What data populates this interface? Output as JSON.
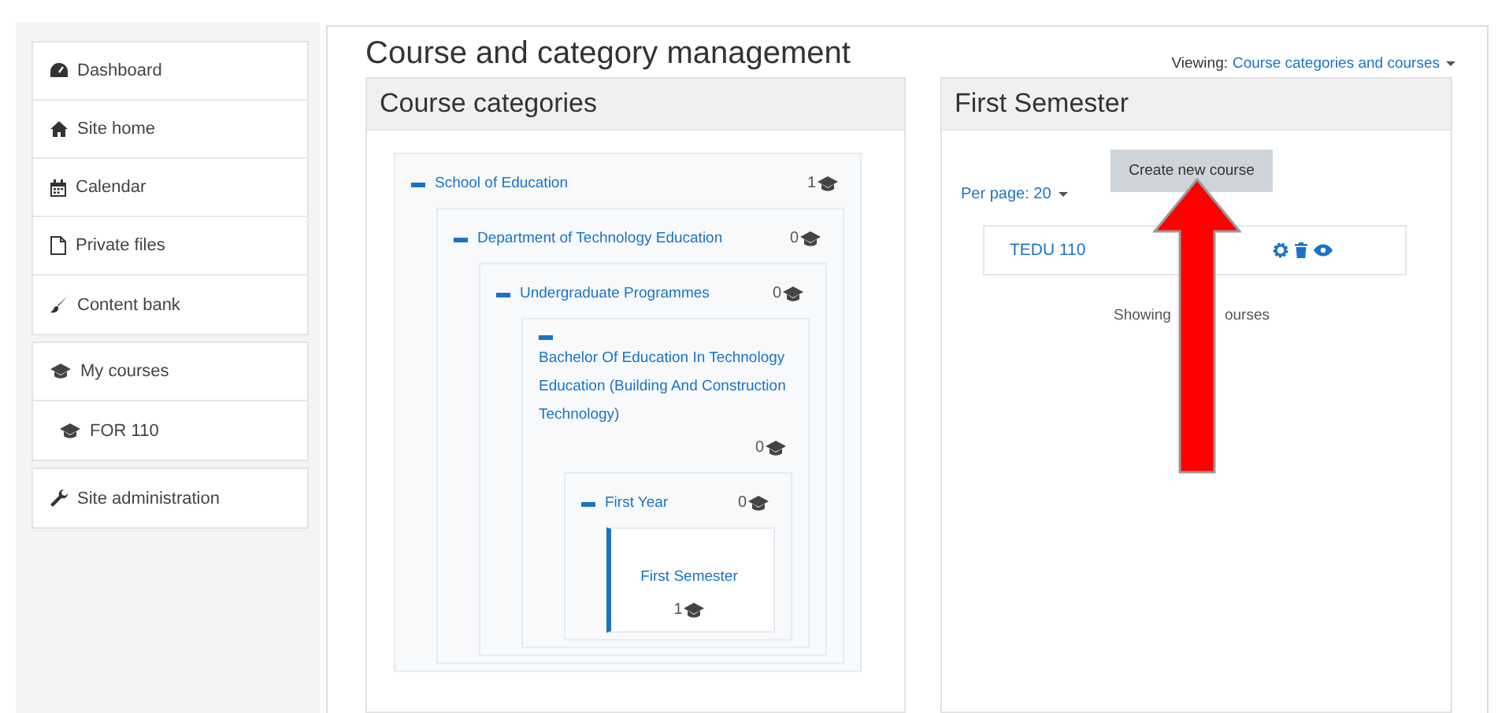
{
  "sidebar": {
    "groups": [
      {
        "items": [
          {
            "label": "Dashboard",
            "kind": "dashboard"
          },
          {
            "label": "Site home",
            "kind": "home"
          },
          {
            "label": "Calendar",
            "kind": "calendar"
          },
          {
            "label": "Private files",
            "kind": "file"
          },
          {
            "label": "Content bank",
            "kind": "brush"
          }
        ]
      },
      {
        "items": [
          {
            "label": "My courses",
            "kind": "cap"
          },
          {
            "label": "FOR 110",
            "kind": "cap",
            "indent": true
          }
        ]
      },
      {
        "items": [
          {
            "label": "Site administration",
            "kind": "wrench"
          }
        ]
      }
    ]
  },
  "page_title": "Course and category management",
  "viewing": {
    "label": "Viewing:",
    "value": "Course categories and courses"
  },
  "categories_panel": {
    "title": "Course categories",
    "tree": [
      {
        "name": "School of Education",
        "count": "1",
        "expanded": true,
        "selected": false,
        "children": [
          {
            "name": "Department of Technology Education",
            "count": "0",
            "expanded": true,
            "selected": false,
            "children": [
              {
                "name": "Undergraduate Programmes",
                "count": "0",
                "expanded": true,
                "selected": false,
                "children": [
                  {
                    "name": "Bachelor Of Education In Technology Education (Building And Construction Technology)",
                    "count": "0",
                    "expanded": true,
                    "selected": false,
                    "children": [
                      {
                        "name": "First Year",
                        "count": "0",
                        "expanded": true,
                        "selected": false,
                        "children": [
                          {
                            "name": "First Semester",
                            "count": "1",
                            "expanded": false,
                            "selected": true
                          }
                        ]
                      }
                    ]
                  }
                ]
              }
            ]
          }
        ]
      }
    ]
  },
  "course_panel": {
    "title": "First Semester",
    "create_button": "Create new course",
    "per_page": "Per page: 20",
    "courses": [
      {
        "name": "TEDU 110"
      }
    ],
    "showing": [
      "Showing",
      "ourses"
    ]
  }
}
